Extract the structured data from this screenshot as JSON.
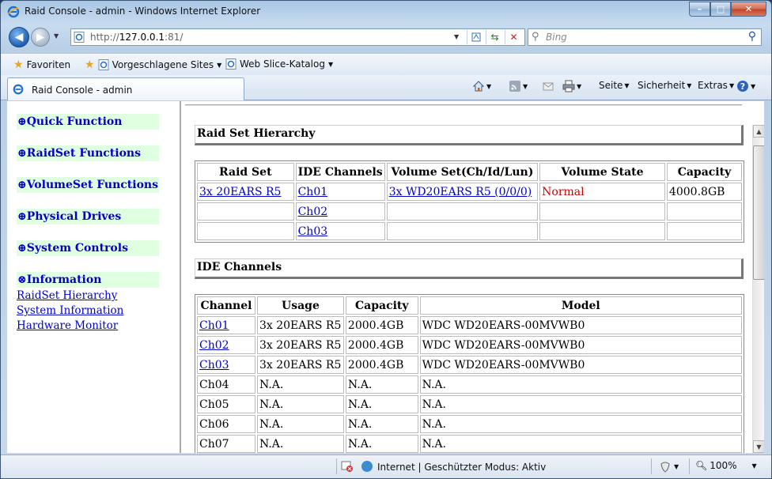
{
  "window": {
    "title": "Raid Console - admin - Windows Internet Explorer",
    "minimize_glyph": "–",
    "maximize_glyph": "□",
    "close_glyph": "✕"
  },
  "navbar": {
    "url_prefix": "http://",
    "url_host": "127.0.0.1",
    "url_suffix": ":81/",
    "search_placeholder": "Bing",
    "back_glyph": "◀",
    "forward_glyph": "▶"
  },
  "favorites": {
    "favorites_label": "Favoriten",
    "suggested_label": "Vorgeschlagene Sites",
    "webslice_label": "Web Slice-Katalog"
  },
  "tab": {
    "label": "Raid Console - admin"
  },
  "commandbar": {
    "page_label": "Seite",
    "safety_label": "Sicherheit",
    "extras_label": "Extras"
  },
  "sidebar": {
    "groups": [
      {
        "label": "⊕Quick Function"
      },
      {
        "label": "⊕RaidSet Functions"
      },
      {
        "label": "⊕VolumeSet Functions"
      },
      {
        "label": "⊕Physical Drives"
      },
      {
        "label": "⊕System Controls"
      },
      {
        "label": "⊗Information"
      }
    ],
    "info_links": [
      "RaidSet Hierarchy",
      "System Information",
      "Hardware Monitor"
    ]
  },
  "raidset_section": {
    "title": "Raid Set Hierarchy",
    "headers": [
      "Raid Set",
      "IDE Channels",
      "Volume Set(Ch/Id/Lun)",
      "Volume State",
      "Capacity"
    ],
    "rows": [
      {
        "raid_set": "3x 20EARS R5",
        "channel": "Ch01",
        "volume_set": "3x WD20EARS R5 (0/0/0)",
        "state": "Normal",
        "capacity": "4000.8GB"
      },
      {
        "raid_set": "",
        "channel": "Ch02",
        "volume_set": "",
        "state": "",
        "capacity": ""
      },
      {
        "raid_set": "",
        "channel": "Ch03",
        "volume_set": "",
        "state": "",
        "capacity": ""
      }
    ]
  },
  "ide_section": {
    "title": "IDE Channels",
    "headers": [
      "Channel",
      "Usage",
      "Capacity",
      "Model"
    ],
    "rows": [
      {
        "channel": "Ch01",
        "usage": "3x 20EARS R5",
        "capacity": "2000.4GB",
        "model": "WDC WD20EARS-00MVWB0"
      },
      {
        "channel": "Ch02",
        "usage": "3x 20EARS R5",
        "capacity": "2000.4GB",
        "model": "WDC WD20EARS-00MVWB0"
      },
      {
        "channel": "Ch03",
        "usage": "3x 20EARS R5",
        "capacity": "2000.4GB",
        "model": "WDC WD20EARS-00MVWB0"
      },
      {
        "channel": "Ch04",
        "usage": "N.A.",
        "capacity": "N.A.",
        "model": "N.A."
      },
      {
        "channel": "Ch05",
        "usage": "N.A.",
        "capacity": "N.A.",
        "model": "N.A."
      },
      {
        "channel": "Ch06",
        "usage": "N.A.",
        "capacity": "N.A.",
        "model": "N.A."
      },
      {
        "channel": "Ch07",
        "usage": "N.A.",
        "capacity": "N.A.",
        "model": "N.A."
      }
    ]
  },
  "statusbar": {
    "zone_text": "Internet | Geschützter Modus: Aktiv",
    "zoom": "100%"
  },
  "colors": {
    "link": "#0000cc",
    "menu_bg": "#e0ffe0",
    "state_normal": "#cc0000"
  }
}
